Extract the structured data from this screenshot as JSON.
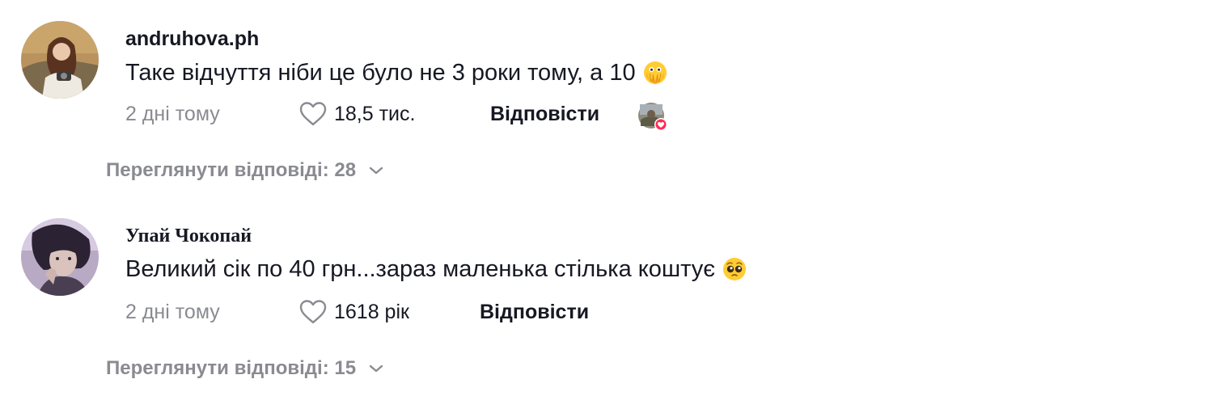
{
  "comments": [
    {
      "username": "andruhova.ph",
      "text": "Таке відчуття ніби це було не 3 роки тому, а 10",
      "emoji": "face-with-open-eyes-and-hand-over-mouth",
      "date": "2 дні тому",
      "likes": "18,5 тис.",
      "reply_label": "Відповісти",
      "view_replies": "Переглянути відповіді: 28",
      "liked_by_creator": true
    },
    {
      "username": "Упай Чокопай",
      "text": "Великий сік по 40 грн...зараз маленька стілька коштує",
      "emoji": "pleading-face",
      "date": "2 дні тому",
      "likes": "1618 рік",
      "reply_label": "Відповісти",
      "view_replies": "Переглянути відповіді: 15",
      "liked_by_creator": false
    }
  ],
  "colors": {
    "primary_text": "#161823",
    "secondary_text": "#8a8b91",
    "creator_heart": "#fe2c55"
  }
}
